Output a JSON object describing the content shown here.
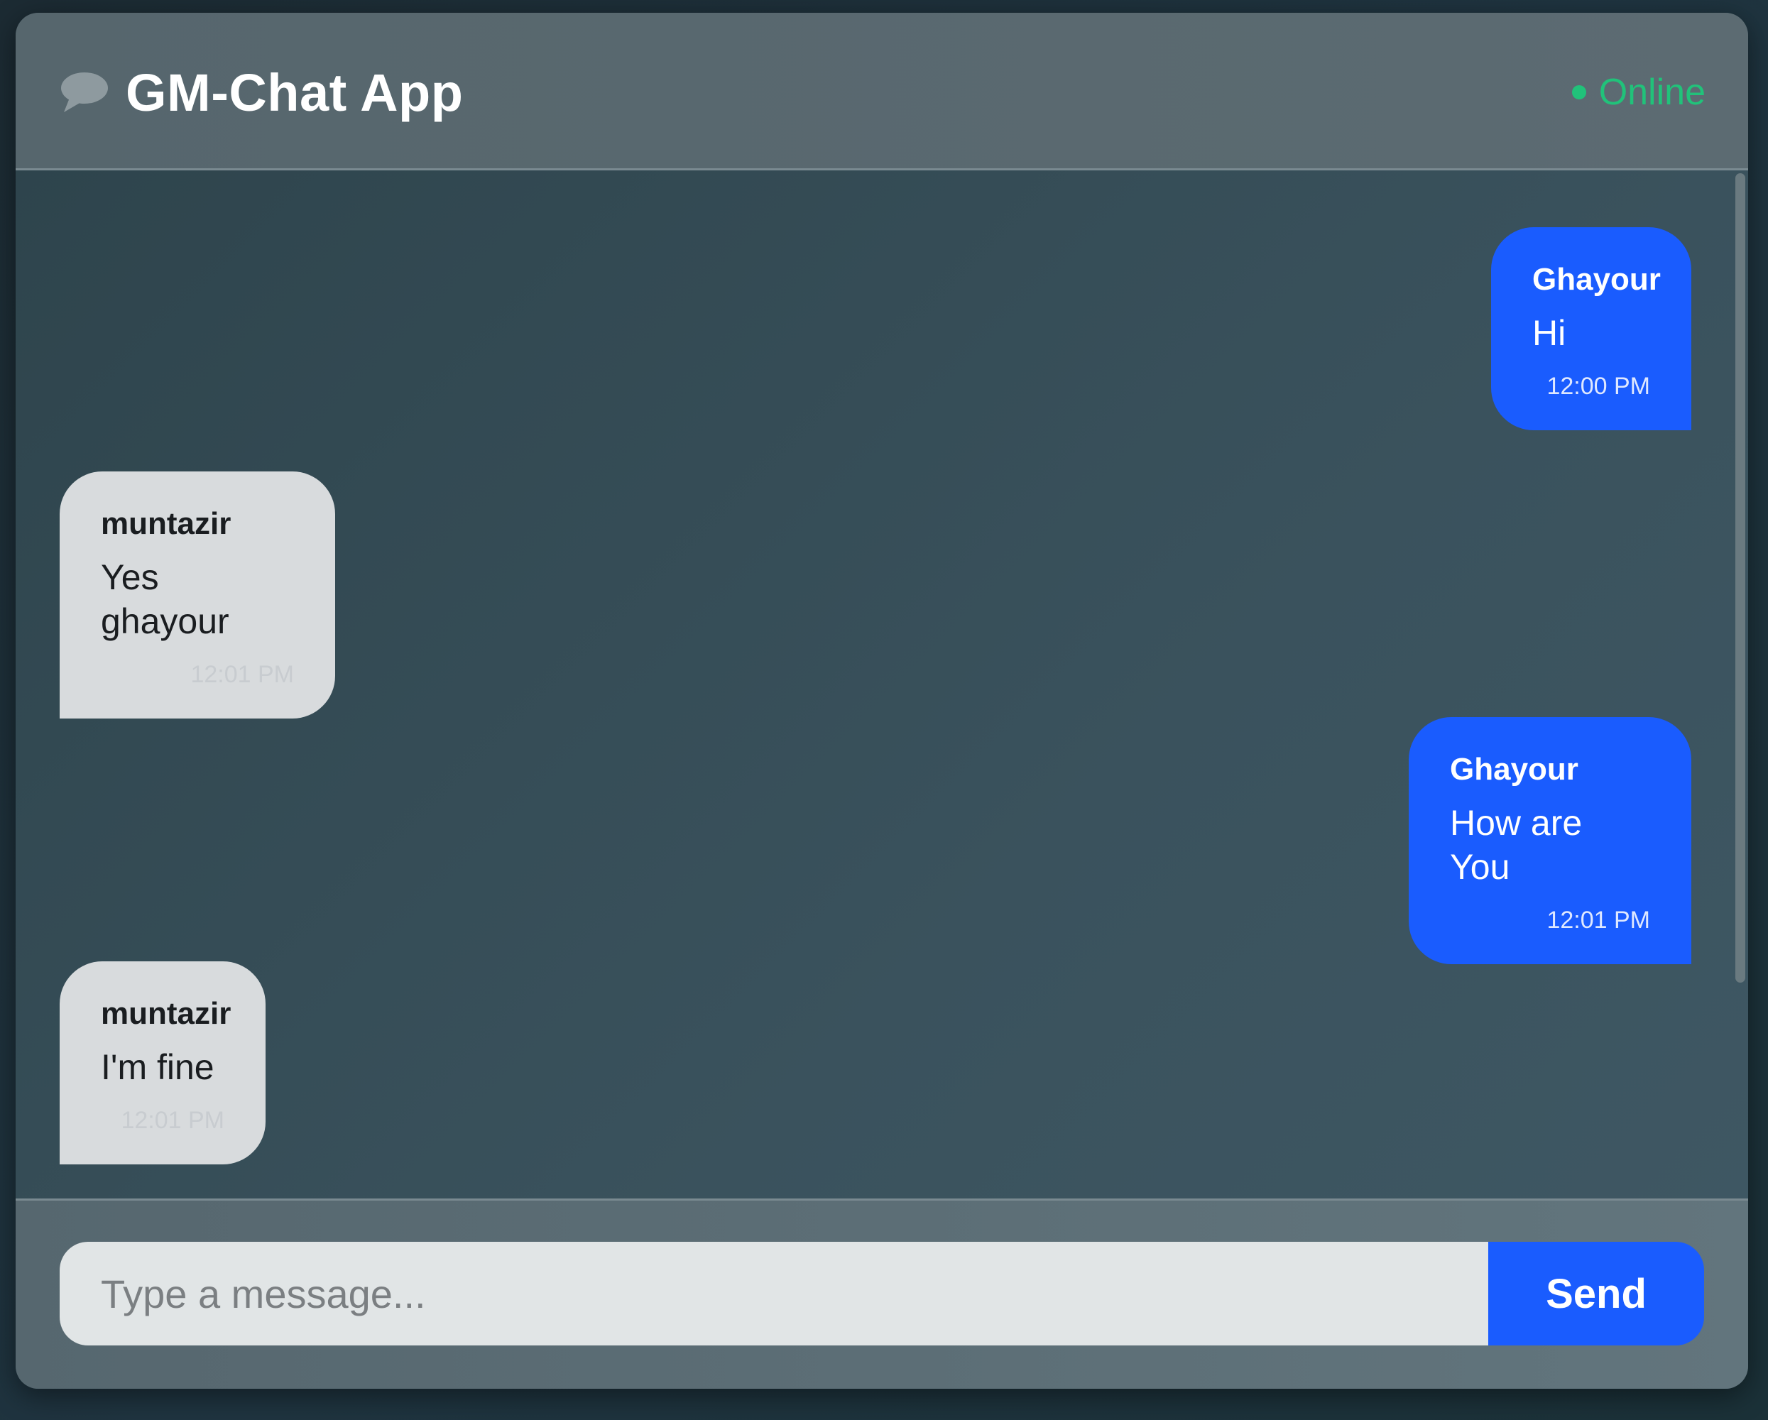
{
  "header": {
    "icon": "chat-bubble-icon",
    "title": "GM-Chat App",
    "status": "Online",
    "status_color": "#21c27a"
  },
  "messages": [
    {
      "direction": "sent",
      "sender": "Ghayour",
      "text": "Hi",
      "time": "12:00 PM"
    },
    {
      "direction": "received",
      "sender": "muntazir",
      "text": "Yes ghayour",
      "time": "12:01 PM"
    },
    {
      "direction": "sent",
      "sender": "Ghayour",
      "text": "How are You",
      "time": "12:01 PM"
    },
    {
      "direction": "received",
      "sender": "muntazir",
      "text": "I'm fine",
      "time": "12:01 PM"
    }
  ],
  "composer": {
    "placeholder": "Type a message...",
    "send_label": "Send"
  },
  "colors": {
    "sent_bubble": "#1a5cfe",
    "received_bubble": "#d8dbdd"
  }
}
